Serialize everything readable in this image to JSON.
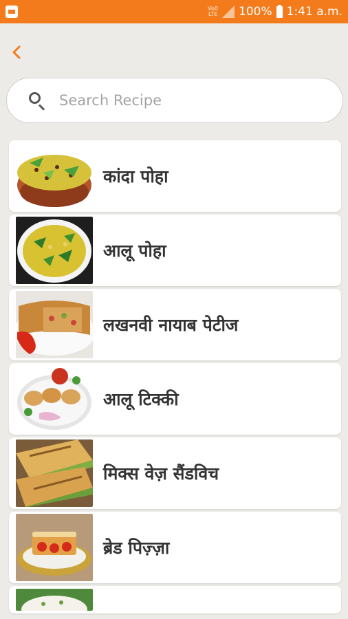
{
  "status_bar": {
    "volte_top": "Vo0",
    "volte_bottom": "LTE",
    "battery_text": "100%",
    "time": "1:41 a.m."
  },
  "search": {
    "placeholder": "Search Recipe",
    "value": ""
  },
  "recipes": [
    {
      "name": "कांदा पोहा",
      "thumb": "kanda-poha-bowl"
    },
    {
      "name": "आलू पोहा",
      "thumb": "aloo-poha-bowl"
    },
    {
      "name": "लखनवी नायाब पेटीज",
      "thumb": "patties-plate"
    },
    {
      "name": "आलू टिक्की",
      "thumb": "aloo-tikki-plate"
    },
    {
      "name": "मिक्स वेज़ सैंडविच",
      "thumb": "sandwich-plate"
    },
    {
      "name": "ब्रेड पिज़्ज़ा",
      "thumb": "bread-pizza-plate"
    },
    {
      "name": "",
      "thumb": "partial-dish"
    }
  ],
  "colors": {
    "accent": "#f47b1b",
    "background": "#ecebe8"
  }
}
